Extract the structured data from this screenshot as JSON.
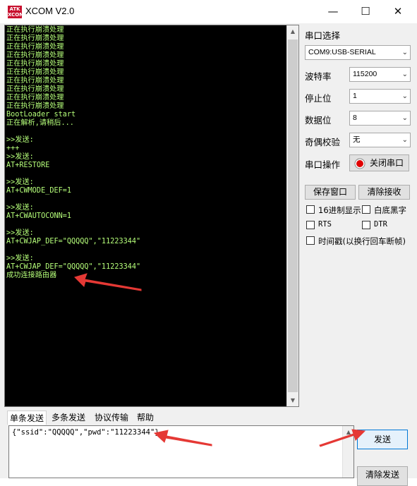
{
  "window": {
    "title": "XCOM V2.0",
    "icon_text": "ATK\nXCOM",
    "minimize_glyph": "—",
    "maximize_glyph": "☐",
    "close_glyph": "✕"
  },
  "terminal": {
    "lines": [
      "正在执行崩溃处理",
      "正在执行崩溃处理",
      "正在执行崩溃处理",
      "正在执行崩溃处理",
      "正在执行崩溃处理",
      "正在执行崩溃处理",
      "正在执行崩溃处理",
      "正在执行崩溃处理",
      "正在执行崩溃处理",
      "正在执行崩溃处理",
      "BootLoader start",
      "正在解析,请稍后...",
      "",
      ">>发送:",
      "+++",
      ">>发送:",
      "AT+RESTORE",
      "",
      ">>发送:",
      "AT+CWMODE_DEF=1",
      "",
      ">>发送:",
      "AT+CWAUTOCONN=1",
      "",
      ">>发送:",
      "AT+CWJAP_DEF=\"QQQQQ\",\"11223344\"",
      "",
      ">>发送:",
      "AT+CWJAP_DEF=\"QQQQQ\",\"11223344\"",
      "成功连接路由器"
    ],
    "text_color": "#b6ff7a",
    "background": "#000000"
  },
  "settings": {
    "port_label": "串口选择",
    "port_value": "COM9:USB-SERIAL",
    "baud_label": "波特率",
    "baud_value": "115200",
    "stop_label": "停止位",
    "stop_value": "1",
    "data_label": "数据位",
    "data_value": "8",
    "parity_label": "奇偶校验",
    "parity_value": "无",
    "op_label": "串口操作",
    "close_port_button": "关闭串口",
    "save_window_button": "保存窗口",
    "clear_receive_button": "清除接收",
    "hex_display_label": "16进制显示",
    "white_bg_label": "白底黑字",
    "rts_label": "RTS",
    "dtr_label": "DTR",
    "timestamp_label": "时间戳(以换行回车断帧)"
  },
  "tabs": [
    "单条发送",
    "多条发送",
    "协议传输",
    "帮助"
  ],
  "send": {
    "text": "{\"ssid\":\"QQQQQ\",\"pwd\":\"11223344\"}",
    "send_button": "发送",
    "clear_send_button": "清除发送"
  },
  "colors": {
    "accent_red": "#e53935",
    "window_bg": "#f0f0f0"
  }
}
